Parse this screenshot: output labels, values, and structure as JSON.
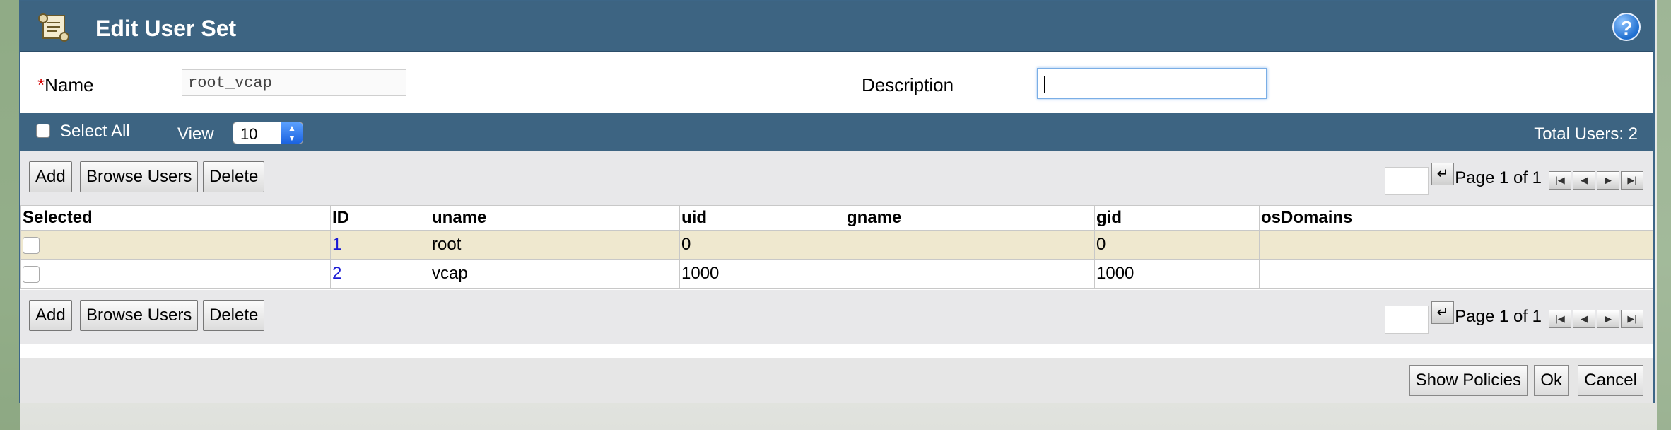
{
  "dialog": {
    "title": "Edit User Set",
    "help_symbol": "?"
  },
  "form": {
    "name_required_marker": "*",
    "name_label": "Name",
    "name_value": "root_vcap",
    "description_label": "Description",
    "description_value": ""
  },
  "toolbar": {
    "select_all_label": "Select All",
    "view_label": "View",
    "view_value": "10",
    "total_users": "Total Users: 2"
  },
  "buttons": {
    "add": "Add",
    "browse_users": "Browse Users",
    "delete": "Delete"
  },
  "pager": {
    "page_text": "Page 1 of 1",
    "go_symbol": "↵",
    "first": "|◀",
    "prev": "◀",
    "next": "▶",
    "last": "▶|"
  },
  "table": {
    "columns": [
      "Selected",
      "ID",
      "uname",
      "uid",
      "gname",
      "gid",
      "osDomains"
    ],
    "rows": [
      {
        "id": "1",
        "uname": "root",
        "uid": "0",
        "gname": "",
        "gid": "0",
        "osDomains": ""
      },
      {
        "id": "2",
        "uname": "vcap",
        "uid": "1000",
        "gname": "",
        "gid": "1000",
        "osDomains": ""
      }
    ]
  },
  "footer": {
    "show_policies": "Show Policies",
    "ok": "Ok",
    "cancel": "Cancel"
  },
  "colors": {
    "header_blue": "#3d6482",
    "row_highlight": "#efe8cf",
    "link_blue": "#1a1ad4",
    "required_red": "#d40000"
  }
}
